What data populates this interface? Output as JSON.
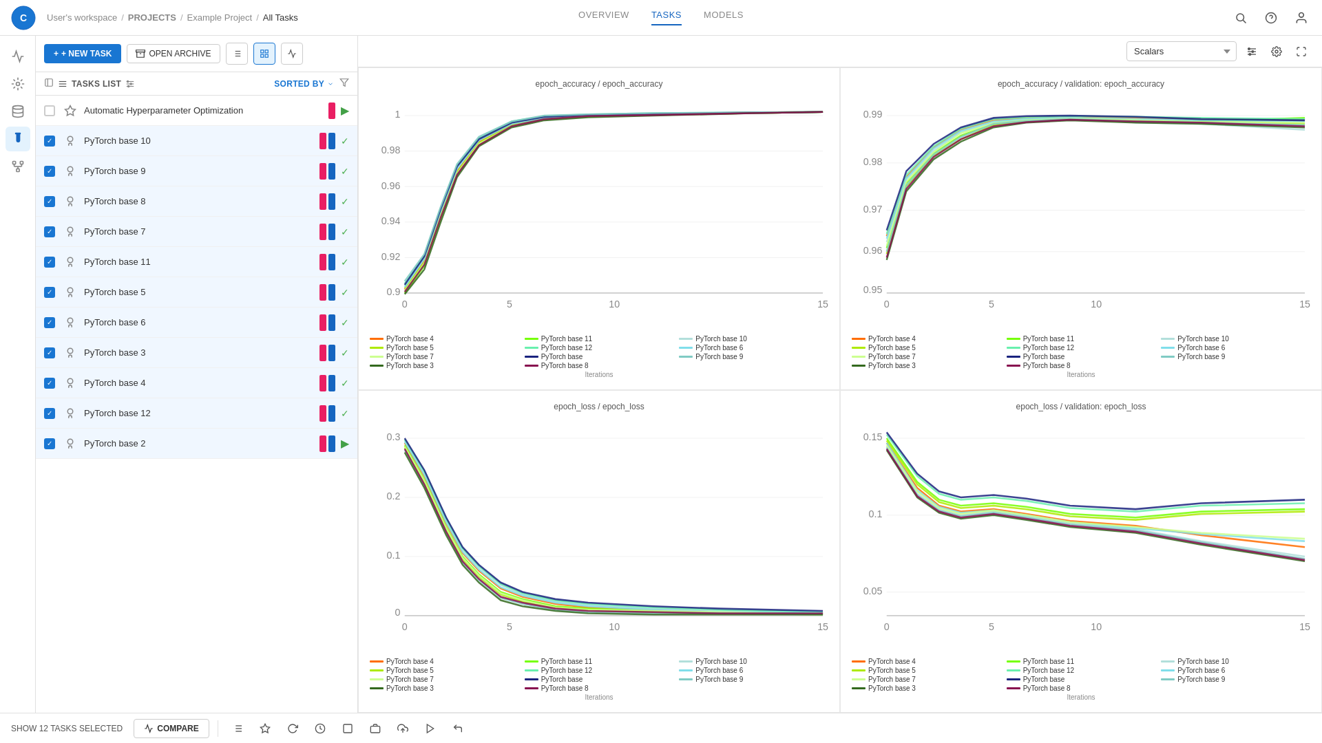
{
  "app": {
    "title": "ClearML"
  },
  "breadcrumb": {
    "workspace": "User's workspace",
    "sep1": "/",
    "projects": "PROJECTS",
    "sep2": "/",
    "project": "Example Project",
    "sep3": "/",
    "current": "All Tasks"
  },
  "nav_tabs": [
    {
      "id": "overview",
      "label": "OVERVIEW",
      "active": false
    },
    {
      "id": "tasks",
      "label": "TASKS",
      "active": true
    },
    {
      "id": "models",
      "label": "MODELS",
      "active": false
    }
  ],
  "toolbar": {
    "new_task_label": "+ NEW TASK",
    "open_archive_label": "OPEN ARCHIVE",
    "scalars_placeholder": "Scalars"
  },
  "task_list_header": {
    "label": "TASKS LIST",
    "sorted_by": "SORTED BY"
  },
  "tasks": [
    {
      "id": 1,
      "name": "Automatic Hyperparameter Optimization",
      "checked": false,
      "color1": "#e91e63",
      "color2": null,
      "status": "play"
    },
    {
      "id": 2,
      "name": "PyTorch base 10",
      "checked": true,
      "color1": "#e91e63",
      "color2": "#1565c0",
      "status": "done"
    },
    {
      "id": 3,
      "name": "PyTorch base 9",
      "checked": true,
      "color1": "#e91e63",
      "color2": "#1565c0",
      "status": "done"
    },
    {
      "id": 4,
      "name": "PyTorch base 8",
      "checked": true,
      "color1": "#e91e63",
      "color2": "#1565c0",
      "status": "done"
    },
    {
      "id": 5,
      "name": "PyTorch base 7",
      "checked": true,
      "color1": "#e91e63",
      "color2": "#1565c0",
      "status": "done"
    },
    {
      "id": 6,
      "name": "PyTorch base 11",
      "checked": true,
      "color1": "#e91e63",
      "color2": "#1565c0",
      "status": "done"
    },
    {
      "id": 7,
      "name": "PyTorch base 5",
      "checked": true,
      "color1": "#e91e63",
      "color2": "#1565c0",
      "status": "done"
    },
    {
      "id": 8,
      "name": "PyTorch base 6",
      "checked": true,
      "color1": "#e91e63",
      "color2": "#1565c0",
      "status": "done"
    },
    {
      "id": 9,
      "name": "PyTorch base 3",
      "checked": true,
      "color1": "#e91e63",
      "color2": "#1565c0",
      "status": "done"
    },
    {
      "id": 10,
      "name": "PyTorch base 4",
      "checked": true,
      "color1": "#e91e63",
      "color2": "#1565c0",
      "status": "done"
    },
    {
      "id": 11,
      "name": "PyTorch base 12",
      "checked": true,
      "color1": "#e91e63",
      "color2": "#1565c0",
      "status": "done"
    },
    {
      "id": 12,
      "name": "PyTorch base 2",
      "checked": true,
      "color1": "#e91e63",
      "color2": "#1565c0",
      "status": "play"
    }
  ],
  "charts": [
    {
      "id": "chart1",
      "title": "epoch_accuracy / epoch_accuracy",
      "x_label": "Iterations",
      "y_min": 0.9,
      "y_max": 1.0,
      "x_max": 15
    },
    {
      "id": "chart2",
      "title": "epoch_accuracy / validation: epoch_accuracy",
      "x_label": "Iterations",
      "y_min": 0.95,
      "y_max": 0.99,
      "x_max": 15
    },
    {
      "id": "chart3",
      "title": "epoch_loss / epoch_loss",
      "x_label": "Iterations",
      "y_min": 0.0,
      "y_max": 0.3,
      "x_max": 15
    },
    {
      "id": "chart4",
      "title": "epoch_loss / validation: epoch_loss",
      "x_label": "Iterations",
      "y_min": 0.05,
      "y_max": 0.15,
      "x_max": 15
    }
  ],
  "legend_items": [
    {
      "label": "PyTorch base 4",
      "color": "#ff6d00"
    },
    {
      "label": "PyTorch base 11",
      "color": "#76ff03"
    },
    {
      "label": "PyTorch base 10",
      "color": "#b2dfdb"
    },
    {
      "label": "PyTorch base 5",
      "color": "#aeea00"
    },
    {
      "label": "PyTorch base 12",
      "color": "#69f0ae"
    },
    {
      "label": "PyTorch base 6",
      "color": "#80deea"
    },
    {
      "label": "PyTorch base 7",
      "color": "#ccff90"
    },
    {
      "label": "PyTorch base",
      "color": "#1a237e"
    },
    {
      "label": "PyTorch base 9",
      "color": "#80cbc4"
    },
    {
      "label": "PyTorch base 3",
      "color": "#33691e"
    },
    {
      "label": "PyTorch base 8",
      "color": "#880e4f"
    }
  ],
  "bottom_bar": {
    "show_selected": "SHOW 12 TASKS SELECTED",
    "compare_label": "COMPARE"
  },
  "colors": {
    "primary": "#1976d2",
    "accent": "#1565c0",
    "success": "#4caf50"
  }
}
